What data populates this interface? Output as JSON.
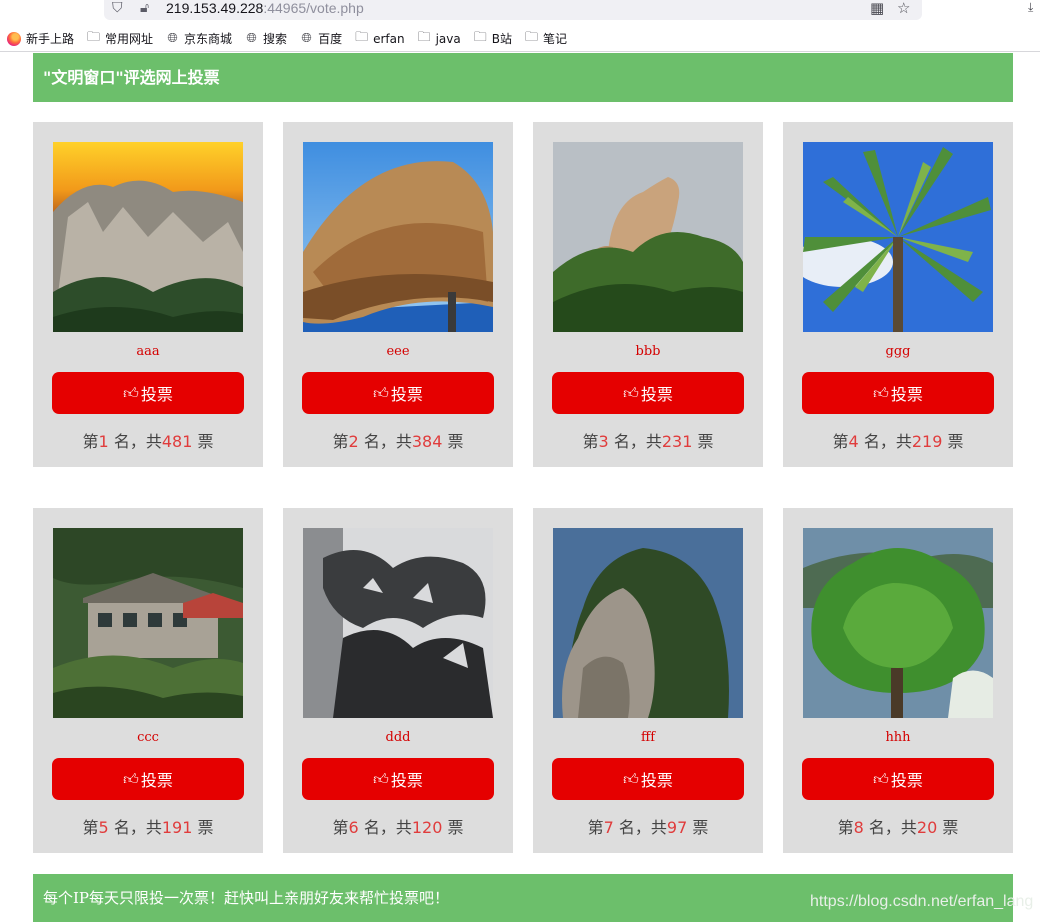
{
  "browser": {
    "url_host": "219.153.49.228",
    "url_rest": ":44965/vote.php",
    "bookmarks": [
      {
        "label": "新手上路",
        "icon": "firefox-icon"
      },
      {
        "label": "常用网址",
        "icon": "folder-icon"
      },
      {
        "label": "京东商城",
        "icon": "globe-icon"
      },
      {
        "label": "搜索",
        "icon": "globe-icon"
      },
      {
        "label": "百度",
        "icon": "globe-icon"
      },
      {
        "label": "erfan",
        "icon": "folder-icon"
      },
      {
        "label": "java",
        "icon": "folder-icon"
      },
      {
        "label": "B站",
        "icon": "folder-icon"
      },
      {
        "label": "笔记",
        "icon": "folder-icon"
      }
    ]
  },
  "header": {
    "title": "\"文明窗口\"评选网上投票"
  },
  "vote_label": "投票",
  "rank_text": {
    "prefix": "第",
    "mid": " 名，共",
    "suffix": " 票"
  },
  "candidates": [
    {
      "name": "aaa",
      "rank": "1",
      "votes": "481"
    },
    {
      "name": "eee",
      "rank": "2",
      "votes": "384"
    },
    {
      "name": "bbb",
      "rank": "3",
      "votes": "231"
    },
    {
      "name": "ggg",
      "rank": "4",
      "votes": "219"
    },
    {
      "name": "ccc",
      "rank": "5",
      "votes": "191"
    },
    {
      "name": "ddd",
      "rank": "6",
      "votes": "120"
    },
    {
      "name": "fff",
      "rank": "7",
      "votes": "97"
    },
    {
      "name": "hhh",
      "rank": "8",
      "votes": "20"
    }
  ],
  "footer": {
    "notice": "每个IP每天只限投一次票！赶快叫上亲朋好友来帮忙投票吧！"
  },
  "watermark": "https://blog.csdn.net/erfan_lang",
  "colors": {
    "accent_green": "#6cbf6b",
    "button_red": "#e50000",
    "name_red": "#d40000",
    "card_gray": "#dddddd"
  }
}
